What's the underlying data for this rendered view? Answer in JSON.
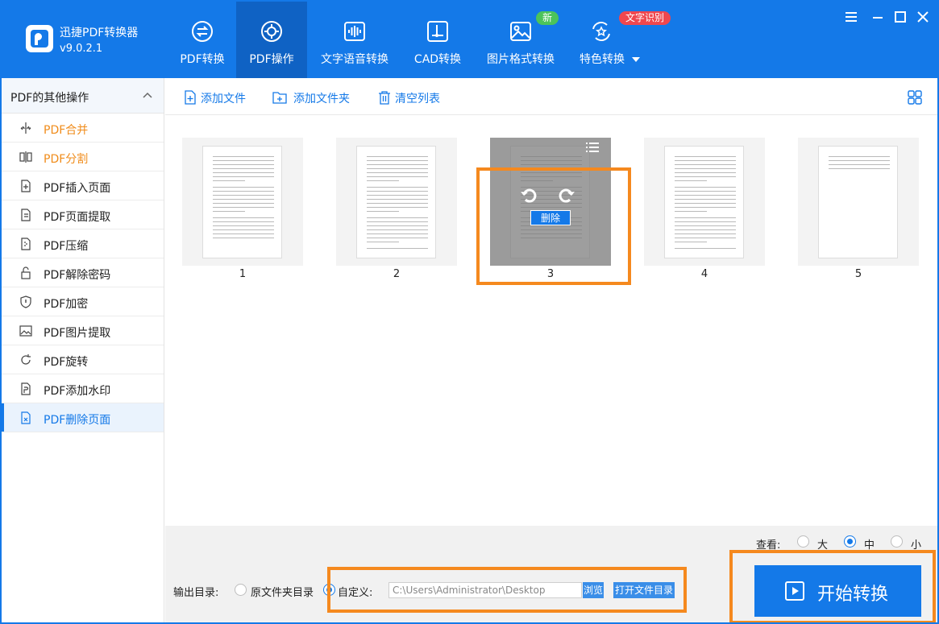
{
  "app": {
    "name": "迅捷PDF转换器",
    "version": "v9.0.2.1"
  },
  "nav": {
    "tabs": [
      {
        "label": "PDF转换",
        "icon": "pdf-convert-icon"
      },
      {
        "label": "PDF操作",
        "icon": "pdf-operate-icon",
        "active": true
      },
      {
        "label": "文字语音转换",
        "icon": "audio-wave-icon"
      },
      {
        "label": "CAD转换",
        "icon": "cad-icon"
      },
      {
        "label": "图片格式转换",
        "icon": "image-icon",
        "badge": "新"
      },
      {
        "label": "特色转换",
        "icon": "star-convert-icon",
        "badge": "文字识别"
      }
    ]
  },
  "sidebar": {
    "header": "PDF的其他操作",
    "items": [
      {
        "label": "PDF合并",
        "icon": "merge-icon"
      },
      {
        "label": "PDF分割",
        "icon": "split-icon"
      },
      {
        "label": "PDF插入页面",
        "icon": "insert-page-icon"
      },
      {
        "label": "PDF页面提取",
        "icon": "extract-page-icon"
      },
      {
        "label": "PDF压缩",
        "icon": "compress-icon"
      },
      {
        "label": "PDF解除密码",
        "icon": "unlock-icon"
      },
      {
        "label": "PDF加密",
        "icon": "shield-icon"
      },
      {
        "label": "PDF图片提取",
        "icon": "image-extract-icon"
      },
      {
        "label": "PDF旋转",
        "icon": "rotate-icon"
      },
      {
        "label": "PDF添加水印",
        "icon": "watermark-icon"
      },
      {
        "label": "PDF删除页面",
        "icon": "delete-page-icon",
        "selected": true
      }
    ]
  },
  "toolbar": {
    "add_file": "添加文件",
    "add_folder": "添加文件夹",
    "clear_list": "清空列表"
  },
  "pages": {
    "numbers": [
      "1",
      "2",
      "3",
      "4",
      "5"
    ],
    "delete_label": "删除"
  },
  "view": {
    "label": "查看:",
    "options": [
      "大",
      "中",
      "小"
    ],
    "selected": "中"
  },
  "output": {
    "label": "输出目录:",
    "original_dir": "原文件夹目录",
    "custom_label": "自定义:",
    "path": "C:\\Users\\Administrator\\Desktop",
    "browse": "浏览",
    "open_dir": "打开文件目录"
  },
  "start_button": "开始转换",
  "colors": {
    "brand": "#1479e8",
    "highlight": "#f5891e",
    "active_side": "#f08c1b"
  }
}
